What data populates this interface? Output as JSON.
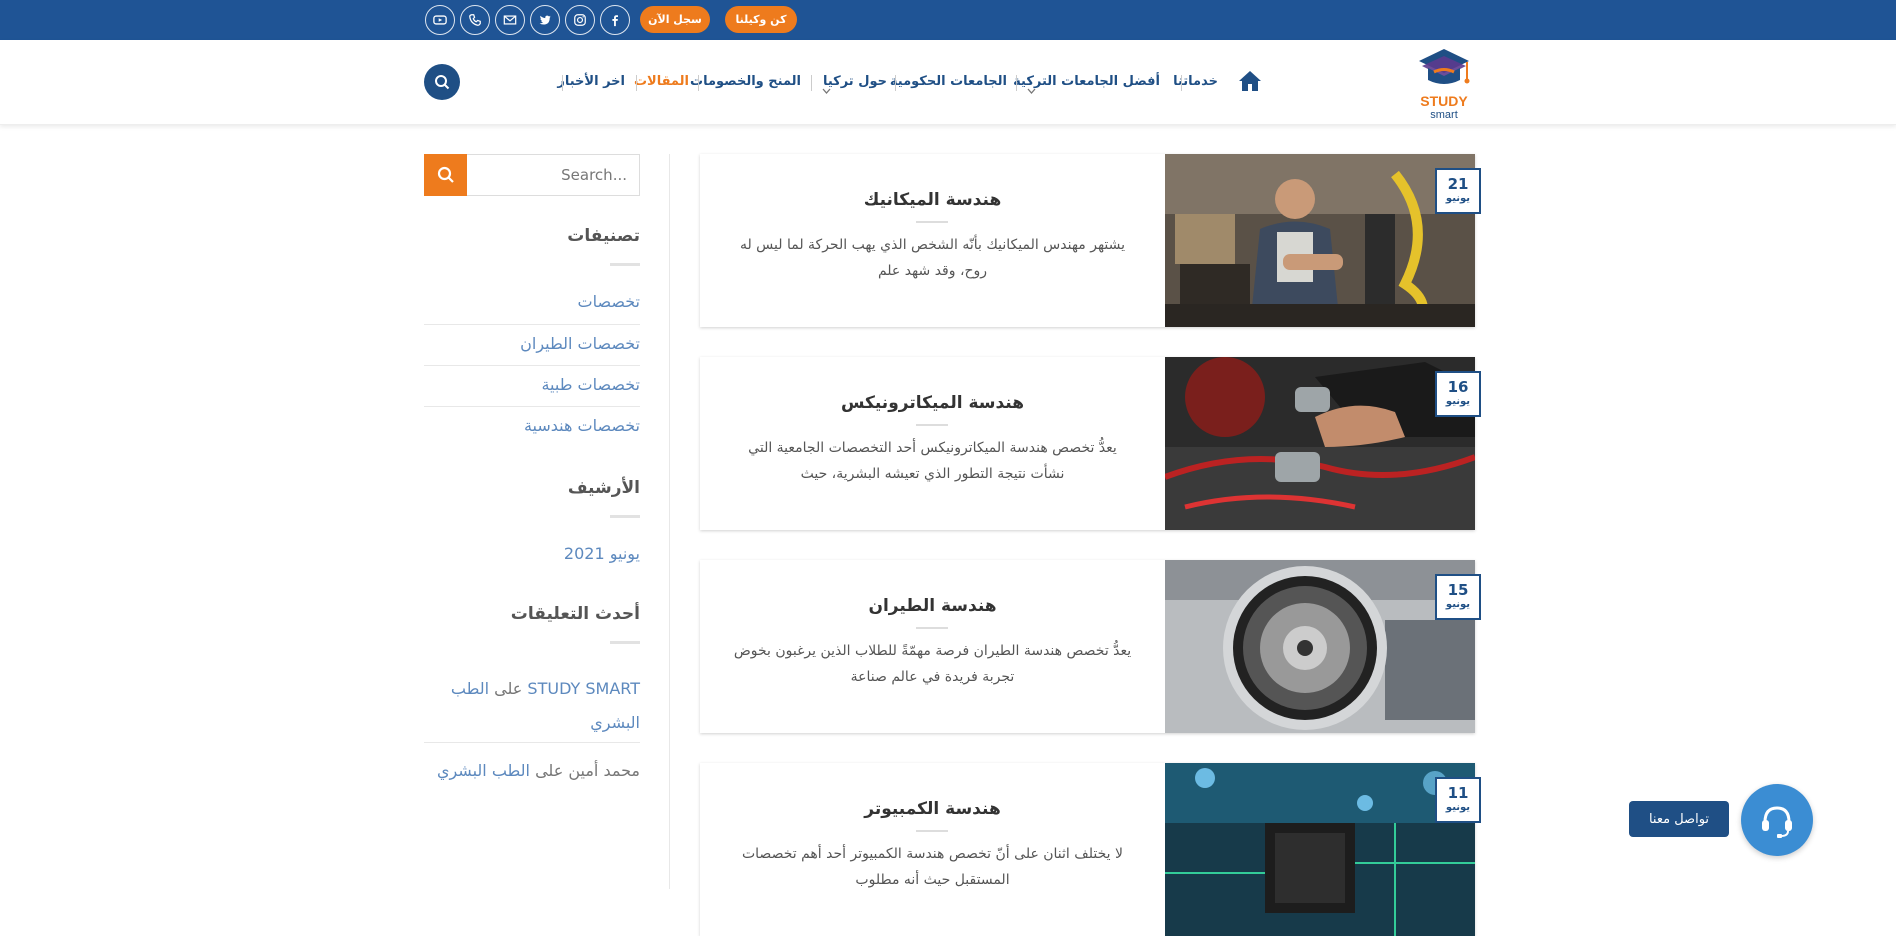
{
  "topbar": {
    "agent_button": "كن وكيلنا",
    "register_button": "سجل الآن",
    "social_icons": [
      "facebook-icon",
      "instagram-icon",
      "twitter-icon",
      "email-icon",
      "phone-icon",
      "youtube-icon"
    ]
  },
  "brand": {
    "logo_line1": "STUDY",
    "logo_line2": "smart"
  },
  "nav": {
    "items": [
      {
        "label": "خدماتنا",
        "dropdown": false
      },
      {
        "label": "أفضل الجامعات التركية",
        "dropdown": true
      },
      {
        "label": "الجامعات الحكومية",
        "dropdown": false
      },
      {
        "label": "حول تركيا",
        "dropdown": true
      },
      {
        "label": "المنح والخصومات",
        "dropdown": false
      },
      {
        "label": "المقالات",
        "dropdown": false,
        "active": true
      },
      {
        "label": "اخر الأخبار",
        "dropdown": false
      }
    ],
    "active_color": "#ee7b1d"
  },
  "posts": [
    {
      "day": "21",
      "month": "يونيو",
      "title": "هندسة الميكانيك",
      "excerpt": "يشتهر مهندس الميكانيك بأنّه الشخص الذي يهب الحركة لما ليس له روح، وقد شهد علم"
    },
    {
      "day": "16",
      "month": "يونيو",
      "title": "هندسة الميكاترونيكس",
      "excerpt": "يعدُّ تخصص هندسة الميكاترونيكس أحد التخصصات الجامعية التي نشأت نتيجة التطور الذي تعيشه البشرية، حيث"
    },
    {
      "day": "15",
      "month": "يونيو",
      "title": "هندسة الطيران",
      "excerpt": "يعدُّ تخصص هندسة الطيران فرصة مهمّةً للطلاب الذين يرغبون بخوض تجربة فريدة في عالم صناعة"
    },
    {
      "day": "11",
      "month": "يونيو",
      "title": "هندسة الكمبيوتر",
      "excerpt": "لا يختلف اثنان على أنّ تخصص هندسة الكمبيوتر أحد أهم تخصصات المستقبل حيث أنه مطلوب"
    }
  ],
  "sidebar": {
    "search_placeholder": "Search...",
    "categories_title": "تصنيفات",
    "categories": [
      "تخصصات",
      "تخصصات الطيران",
      "تخصصات طبية",
      "تخصصات هندسية"
    ],
    "archive_title": "الأرشيف",
    "archive": [
      "يونيو 2021"
    ],
    "comments_title": "أحدث التعليقات",
    "comments": [
      {
        "author": "STUDY SMART",
        "on": "على",
        "post": "الطب البشري"
      },
      {
        "author": "محمد أمين",
        "on": "على",
        "post": "الطب البشري"
      }
    ]
  },
  "contact": {
    "label": "تواصل معنا"
  },
  "colors": {
    "brand_blue": "#1f5495",
    "accent_orange": "#ee7b1d",
    "link_blue": "#5d89be"
  }
}
